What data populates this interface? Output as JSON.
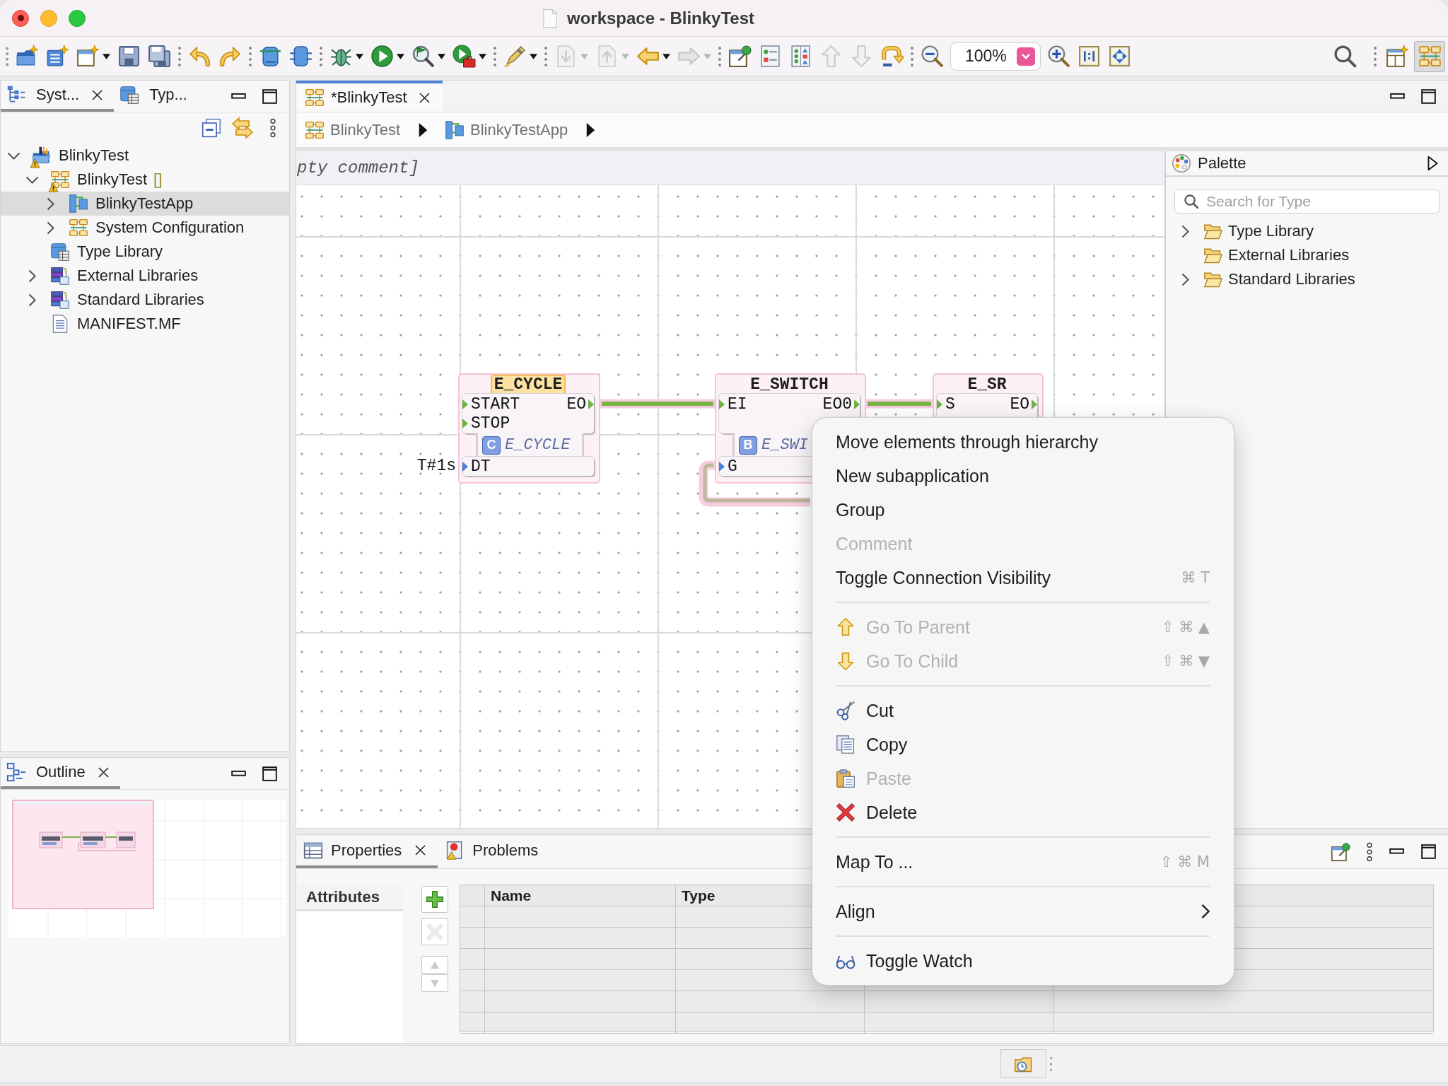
{
  "window": {
    "title": "workspace - BlinkyTest",
    "unsaved": true
  },
  "toolbar": {
    "items": [
      {
        "kind": "button",
        "disabled": false,
        "dropdown": false
      },
      {
        "kind": "button",
        "disabled": false,
        "dropdown": false
      },
      {
        "kind": "button",
        "disabled": false,
        "dropdown": true
      },
      {
        "kind": "button",
        "disabled": false,
        "dropdown": false
      },
      {
        "kind": "button",
        "disabled": false,
        "dropdown": false
      },
      {
        "kind": "separator"
      },
      {
        "kind": "button",
        "disabled": false,
        "dropdown": false
      },
      {
        "kind": "button",
        "disabled": false,
        "dropdown": false
      },
      {
        "kind": "separator"
      },
      {
        "kind": "button",
        "disabled": false,
        "dropdown": false
      },
      {
        "kind": "button",
        "disabled": false,
        "dropdown": false
      },
      {
        "kind": "separator"
      },
      {
        "kind": "button",
        "disabled": false,
        "dropdown": true
      },
      {
        "kind": "button",
        "disabled": false,
        "dropdown": true
      },
      {
        "kind": "button",
        "disabled": false,
        "dropdown": true
      },
      {
        "kind": "button",
        "disabled": false,
        "dropdown": true
      },
      {
        "kind": "separator"
      },
      {
        "kind": "button",
        "disabled": false,
        "dropdown": true
      },
      {
        "kind": "separator"
      },
      {
        "kind": "button",
        "disabled": true,
        "dropdown": true
      },
      {
        "kind": "button",
        "disabled": true,
        "dropdown": true
      },
      {
        "kind": "button",
        "disabled": false,
        "dropdown": true
      },
      {
        "kind": "button",
        "disabled": true,
        "dropdown": true
      },
      {
        "kind": "separator"
      },
      {
        "kind": "button",
        "disabled": false,
        "dropdown": false
      },
      {
        "kind": "button",
        "disabled": false,
        "dropdown": false
      },
      {
        "kind": "button",
        "disabled": false,
        "dropdown": false
      },
      {
        "kind": "button",
        "disabled": true,
        "dropdown": false
      },
      {
        "kind": "button",
        "disabled": true,
        "dropdown": false
      },
      {
        "kind": "button",
        "disabled": false,
        "dropdown": false
      },
      {
        "kind": "separator"
      },
      {
        "kind": "button",
        "disabled": false,
        "dropdown": false
      },
      {
        "kind": "zoom",
        "value": "100%"
      },
      {
        "kind": "button",
        "disabled": false,
        "dropdown": false
      },
      {
        "kind": "button",
        "disabled": false,
        "dropdown": false
      },
      {
        "kind": "button",
        "disabled": false,
        "dropdown": false
      }
    ],
    "right_items": [
      {
        "kind": "button",
        "disabled": false,
        "dropdown": false
      },
      {
        "kind": "separator"
      },
      {
        "kind": "perspective",
        "selected": false
      },
      {
        "kind": "perspective",
        "selected": true
      }
    ]
  },
  "system_explorer": {
    "tabs": [
      {
        "label": "Syst...",
        "selected": true,
        "closable": true
      },
      {
        "label": "Typ...",
        "selected": false,
        "closable": false
      }
    ],
    "tree": [
      {
        "label": "BlinkyTest",
        "kind": "project",
        "warning": true,
        "expandable": true,
        "expanded": true,
        "selected": false,
        "children": [
          {
            "label": "BlinkyTest",
            "decoration": "[]",
            "kind": "system",
            "warning": true,
            "expandable": true,
            "expanded": true,
            "selected": false,
            "children": [
              {
                "label": "BlinkyTestApp",
                "kind": "application",
                "warning": false,
                "expandable": true,
                "expanded": false,
                "selected": true
              },
              {
                "label": "System Configuration",
                "kind": "configuration",
                "warning": false,
                "expandable": true,
                "expanded": false,
                "selected": false
              }
            ]
          },
          {
            "label": "Type Library",
            "kind": "type-library",
            "warning": false,
            "expandable": false,
            "selected": false
          },
          {
            "label": "External Libraries",
            "kind": "library",
            "warning": false,
            "expandable": true,
            "expanded": false,
            "selected": false
          },
          {
            "label": "Standard Libraries",
            "kind": "library",
            "warning": false,
            "expandable": true,
            "expanded": false,
            "selected": false
          },
          {
            "label": "MANIFEST.MF",
            "kind": "file",
            "warning": false,
            "expandable": false,
            "selected": false
          }
        ]
      }
    ]
  },
  "outline": {
    "tabs": [
      {
        "label": "Outline",
        "selected": true,
        "closable": true
      }
    ]
  },
  "editor": {
    "tabs": [
      {
        "label": "*BlinkyTest",
        "selected": true,
        "closable": true
      }
    ],
    "breadcrumb": [
      {
        "label": "BlinkyTest",
        "kind": "system"
      },
      {
        "label": "BlinkyTestApp",
        "kind": "application"
      }
    ],
    "comment": "pty comment]",
    "blocks": [
      {
        "name": "E_CYCLE",
        "selected": true,
        "highlighted": true,
        "type_badge": "C",
        "type": "E_CYCLE",
        "event_inputs": [
          "START",
          "STOP"
        ],
        "event_outputs": [
          "EO"
        ],
        "data_inputs": [
          {
            "name": "DT",
            "value": "T#1s"
          }
        ]
      },
      {
        "name": "E_SWITCH",
        "selected": true,
        "highlighted": false,
        "type_badge": "B",
        "type": "E_SWI",
        "event_inputs": [
          "EI"
        ],
        "event_outputs": [
          "EO0"
        ],
        "data_inputs": [
          {
            "name": "G"
          }
        ]
      },
      {
        "name": "E_SR",
        "selected": true,
        "highlighted": false,
        "event_inputs": [
          "S"
        ],
        "event_outputs": [
          "EO"
        ]
      }
    ]
  },
  "palette": {
    "title": "Palette",
    "search": {
      "placeholder": "Search for Type"
    },
    "items": [
      {
        "label": "Type Library",
        "expandable": true,
        "expanded": false,
        "selected": false
      },
      {
        "label": "External Libraries",
        "expandable": false,
        "selected": false
      },
      {
        "label": "Standard Libraries",
        "expandable": true,
        "expanded": false,
        "selected": false
      }
    ]
  },
  "properties": {
    "tabs": [
      {
        "label": "Properties",
        "selected": true,
        "closable": true
      },
      {
        "label": "Problems",
        "selected": false,
        "closable": false
      }
    ],
    "side_tabs": [
      {
        "label": "Attributes",
        "selected": true
      }
    ],
    "buttons": [
      {
        "disabled": false
      },
      {
        "disabled": true
      },
      {
        "disabled": true
      },
      {
        "disabled": true
      }
    ],
    "columns": [
      "Name",
      "Type"
    ]
  },
  "context_menu": {
    "items": [
      {
        "kind": "command",
        "label": "Move elements through hierarchy",
        "disabled": false,
        "submenu": false
      },
      {
        "kind": "command",
        "label": "New subapplication",
        "disabled": false,
        "submenu": false
      },
      {
        "kind": "command",
        "label": "Group",
        "disabled": false,
        "submenu": false
      },
      {
        "kind": "command",
        "label": "Comment",
        "disabled": true,
        "submenu": false
      },
      {
        "kind": "command",
        "label": "Toggle Connection Visibility",
        "shortcut": "⌘ T",
        "disabled": false,
        "submenu": false
      },
      {
        "kind": "separator"
      },
      {
        "kind": "command",
        "label": "Go To Parent",
        "shortcut": "⇧ ⌘ ▲",
        "disabled": true,
        "submenu": false
      },
      {
        "kind": "command",
        "label": "Go To Child",
        "shortcut": "⇧ ⌘ ▼",
        "disabled": true,
        "submenu": false
      },
      {
        "kind": "separator"
      },
      {
        "kind": "command",
        "label": "Cut",
        "disabled": false,
        "submenu": false
      },
      {
        "kind": "command",
        "label": "Copy",
        "disabled": false,
        "submenu": false
      },
      {
        "kind": "command",
        "label": "Paste",
        "disabled": true,
        "submenu": false
      },
      {
        "kind": "command",
        "label": "Delete",
        "disabled": false,
        "submenu": false
      },
      {
        "kind": "separator"
      },
      {
        "kind": "command",
        "label": "Map To ...",
        "shortcut": "⇧ ⌘ M",
        "disabled": false,
        "submenu": false
      },
      {
        "kind": "separator"
      },
      {
        "kind": "command",
        "label": "Align",
        "disabled": false,
        "submenu": true
      },
      {
        "kind": "separator"
      },
      {
        "kind": "command",
        "label": "Toggle Watch",
        "disabled": false,
        "submenu": false
      }
    ]
  }
}
